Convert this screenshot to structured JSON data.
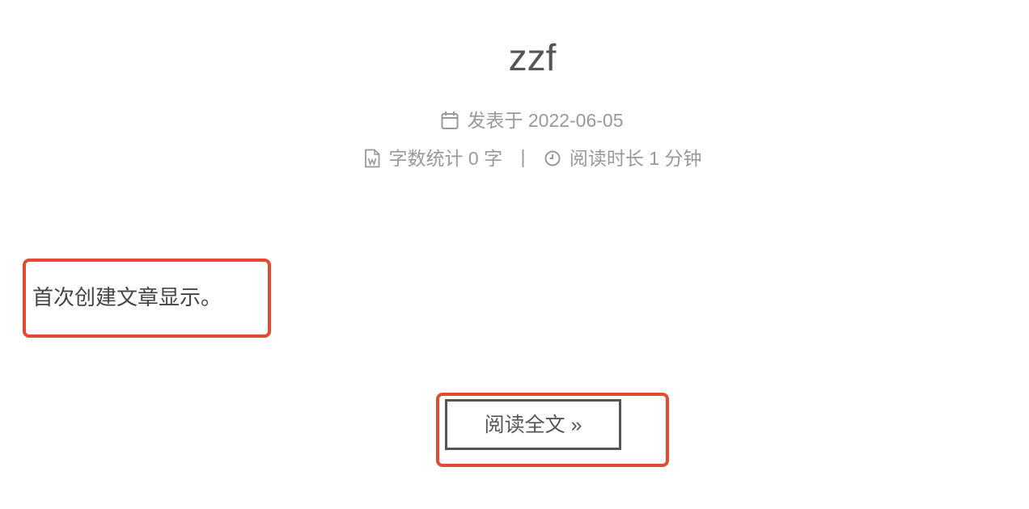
{
  "post": {
    "title": "zzf",
    "meta": {
      "posted_label": "发表于 2022-06-05",
      "word_count_label": "字数统计 0 字",
      "separator": "|",
      "read_time_label": "阅读时长 1 分钟"
    },
    "excerpt": "首次创建文章显示。",
    "read_more_label": "阅读全文 »"
  },
  "icons": {
    "calendar": "calendar-icon",
    "word_file": "word-file-icon",
    "clock": "clock-icon"
  },
  "colors": {
    "title": "#555555",
    "meta": "#999999",
    "highlight": "#e34a33",
    "button_border": "#555555"
  }
}
